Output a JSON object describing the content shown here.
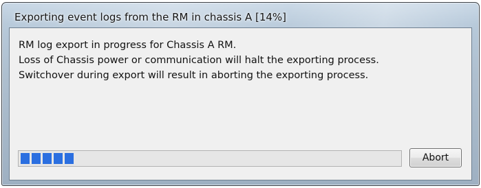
{
  "dialog": {
    "title": "Exporting event logs from the RM in chassis A [14%]",
    "message_lines": [
      "RM log export in progress for Chassis A RM.",
      "Loss of Chassis power or communication will halt the exporting process.",
      "Switchover during export will result in aborting the exporting process."
    ],
    "progress": {
      "fraction": 0.14,
      "color": "#2b6fe0"
    },
    "abort_label": "Abort"
  }
}
